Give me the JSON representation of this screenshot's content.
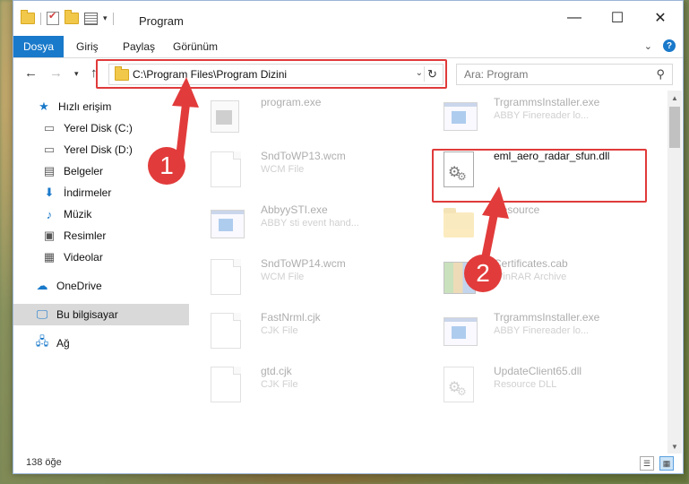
{
  "window": {
    "title": "Program",
    "controls": {
      "minimize": "—",
      "maximize": "☐",
      "close": "✕"
    }
  },
  "ribbon": {
    "file_tab": "Dosya",
    "tabs": [
      "Giriş",
      "Paylaş",
      "Görünüm"
    ]
  },
  "nav": {
    "address": "C:\\Program Files\\Program Dizini",
    "search_placeholder": "Ara: Program"
  },
  "sidebar": {
    "items": [
      {
        "label": "Hızlı erişim",
        "icon": "star-icon"
      },
      {
        "label": "Yerel Disk (C:)",
        "icon": "drive-icon"
      },
      {
        "label": "Yerel Disk (D:)",
        "icon": "drive-icon"
      },
      {
        "label": "Belgeler",
        "icon": "documents-icon"
      },
      {
        "label": "İndirmeler",
        "icon": "download-icon"
      },
      {
        "label": "Müzik",
        "icon": "music-icon"
      },
      {
        "label": "Resimler",
        "icon": "pictures-icon"
      },
      {
        "label": "Videolar",
        "icon": "videos-icon"
      },
      {
        "label": "OneDrive",
        "icon": "cloud-icon"
      },
      {
        "label": "Bu bilgisayar",
        "icon": "computer-icon"
      },
      {
        "label": "Ağ",
        "icon": "network-icon"
      }
    ]
  },
  "files": [
    {
      "name": "program.exe",
      "sub": "",
      "icon": "exe"
    },
    {
      "name": "TrgrammsInstaller.exe",
      "sub": "ABBY Finereader lo...",
      "icon": "app"
    },
    {
      "name": "SndToWP13.wcm",
      "sub": "WCM File",
      "icon": "doc"
    },
    {
      "name": "eml_aero_radar_sfun.dll",
      "sub": "",
      "icon": "dll"
    },
    {
      "name": "AbbyySTI.exe",
      "sub": "ABBY sti event hand...",
      "icon": "app"
    },
    {
      "name": "Resource",
      "sub": "",
      "icon": "folder"
    },
    {
      "name": "SndToWP14.wcm",
      "sub": "WCM File",
      "icon": "doc"
    },
    {
      "name": "Certificates.cab",
      "sub": "WinRAR Archive",
      "icon": "cab"
    },
    {
      "name": "FastNrml.cjk",
      "sub": "CJK File",
      "icon": "doc"
    },
    {
      "name": "TrgrammsInstaller.exe",
      "sub": "ABBY Finereader lo...",
      "icon": "app"
    },
    {
      "name": "gtd.cjk",
      "sub": "CJK File",
      "icon": "doc"
    },
    {
      "name": "UpdateClient65.dll",
      "sub": "Resource DLL",
      "icon": "dll"
    }
  ],
  "status": {
    "count": "138 öğe"
  },
  "annotations": {
    "step1": "1",
    "step2": "2",
    "color": "#e23b3b"
  }
}
